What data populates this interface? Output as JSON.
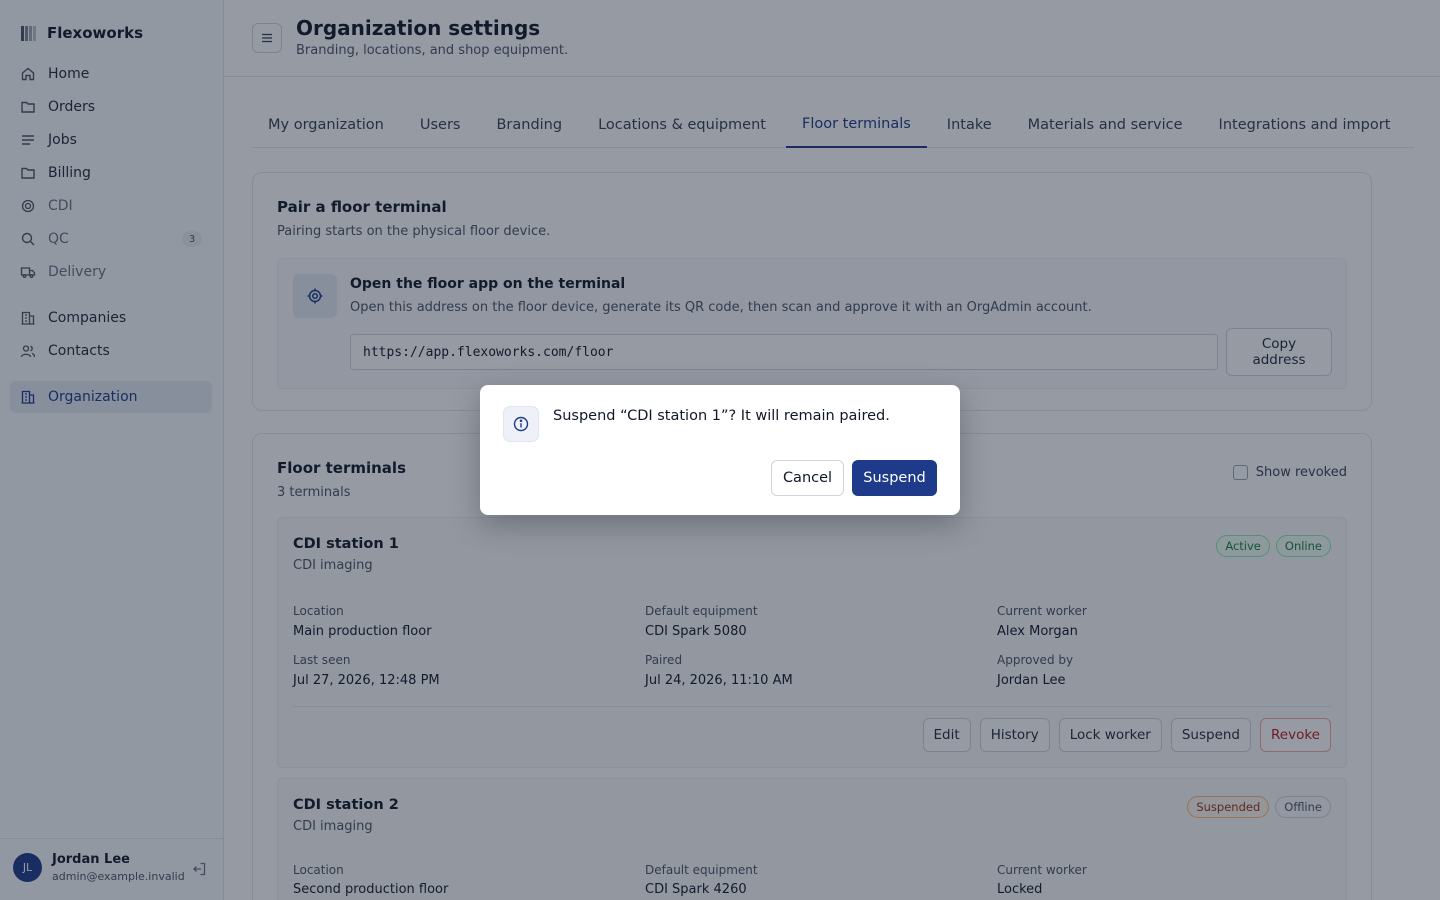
{
  "app": {
    "name": "Flexoworks",
    "logo_icon": "grid-logo-icon"
  },
  "sidebar": {
    "items": [
      {
        "label": "Home",
        "icon": "home-icon"
      },
      {
        "label": "Orders",
        "icon": "folder-icon"
      },
      {
        "label": "Jobs",
        "icon": "list-icon"
      },
      {
        "label": "Billing",
        "icon": "folder-icon"
      },
      {
        "label": "CDI",
        "icon": "target-icon"
      },
      {
        "label": "QC",
        "icon": "search-icon",
        "badge": "3"
      },
      {
        "label": "Delivery",
        "icon": "truck-icon"
      },
      {
        "label": "Companies",
        "icon": "building-icon"
      },
      {
        "label": "Contacts",
        "icon": "users-icon"
      },
      {
        "label": "Organization",
        "icon": "building-icon",
        "active": true
      }
    ]
  },
  "user": {
    "initials": "JL",
    "name": "Jordan Lee",
    "email": "admin@example.invalid"
  },
  "header": {
    "title": "Organization settings",
    "subtitle": "Branding, locations, and shop equipment."
  },
  "tabs": [
    {
      "label": "My organization"
    },
    {
      "label": "Users"
    },
    {
      "label": "Branding"
    },
    {
      "label": "Locations & equipment"
    },
    {
      "label": "Floor terminals",
      "active": true
    },
    {
      "label": "Intake"
    },
    {
      "label": "Materials and service"
    },
    {
      "label": "Integrations and import"
    }
  ],
  "pair": {
    "title": "Pair a floor terminal",
    "subtitle": "Pairing starts on the physical floor device.",
    "box_title": "Open the floor app on the terminal",
    "box_text": "Open this address on the floor device, generate its QR code, then scan and approve it with an OrgAdmin account.",
    "url": "https://app.flexoworks.com/floor",
    "copy_label": "Copy address"
  },
  "terminals_section": {
    "title": "Floor terminals",
    "count": "3 terminals",
    "show_revoked_label": "Show revoked"
  },
  "labels": {
    "location": "Location",
    "default_equipment": "Default equipment",
    "current_worker": "Current worker",
    "last_seen": "Last seen",
    "paired": "Paired",
    "approved_by": "Approved by"
  },
  "terminals": [
    {
      "name": "CDI station 1",
      "type": "CDI imaging",
      "status": "Active",
      "connection": "Online",
      "location": "Main production floor",
      "default_equipment": "CDI Spark 5080",
      "current_worker": "Alex Morgan",
      "last_seen": "Jul 27, 2026, 12:48 PM",
      "paired": "Jul 24, 2026, 11:10 AM",
      "approved_by": "Jordan Lee",
      "actions": [
        "Edit",
        "History",
        "Lock worker",
        "Suspend",
        "Revoke"
      ]
    },
    {
      "name": "CDI station 2",
      "type": "CDI imaging",
      "status": "Suspended",
      "connection": "Offline",
      "location": "Second production floor",
      "default_equipment": "CDI Spark 4260",
      "current_worker": "Locked"
    }
  ],
  "dialog": {
    "message": "Suspend “CDI station 1”? It will remain paired.",
    "cancel_label": "Cancel",
    "confirm_label": "Suspend",
    "icon": "info-icon"
  },
  "colors": {
    "accent": "#1e3a8a",
    "danger": "#b91c1c",
    "success": "#15803d",
    "warning": "#9a3412"
  }
}
